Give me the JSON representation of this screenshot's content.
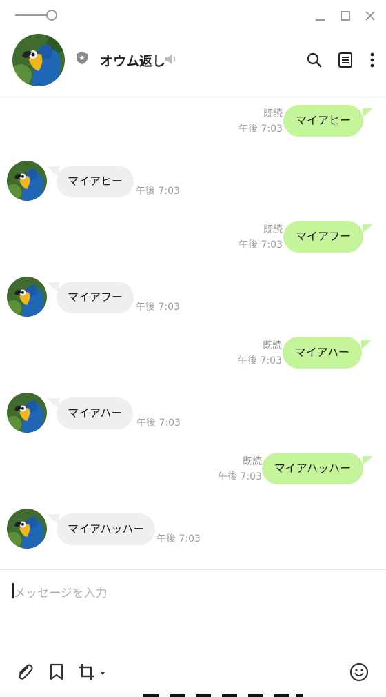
{
  "header": {
    "title": "オウム返し",
    "icons": [
      "shield-icon",
      "speaker-icon",
      "search-icon",
      "notes-icon",
      "more-icon"
    ]
  },
  "colors": {
    "outgoing_bubble": "#c5f49a",
    "incoming_bubble": "#efefef",
    "meta_text": "#9c9c9c"
  },
  "messages": [
    {
      "side": "out",
      "text": "マイアヒー",
      "read": "既読",
      "time": "午後 7:03"
    },
    {
      "side": "in",
      "text": "マイアヒー",
      "time": "午後 7:03"
    },
    {
      "side": "out",
      "text": "マイアフー",
      "read": "既読",
      "time": "午後 7:03"
    },
    {
      "side": "in",
      "text": "マイアフー",
      "time": "午後 7:03"
    },
    {
      "side": "out",
      "text": "マイアハー",
      "read": "既読",
      "time": "午後 7:03"
    },
    {
      "side": "in",
      "text": "マイアハー",
      "time": "午後 7:03"
    },
    {
      "side": "out",
      "text": "マイアハッハー",
      "read": "既読",
      "time": "午後 7:03"
    },
    {
      "side": "in",
      "text": "マイアハッハー",
      "time": "午後 7:03"
    }
  ],
  "input": {
    "placeholder": "メッセージを入力",
    "value": ""
  },
  "toolbar": {
    "icons": [
      "paperclip-icon",
      "bookmark-icon",
      "crop-icon",
      "emoji-icon"
    ]
  }
}
